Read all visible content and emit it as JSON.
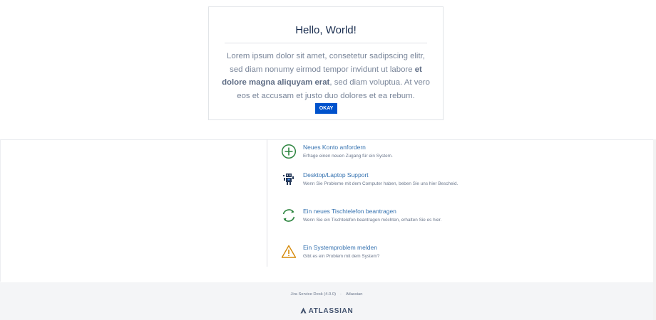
{
  "dialog": {
    "title": "Hello, World!",
    "text_part1": "Lorem ipsum dolor sit amet, consetetur sadipscing elitr, sed diam nonumy eirmod tempor invidunt ut labore ",
    "text_bold": "et dolore magna aliquyam erat",
    "text_part2": ", sed diam voluptua. At vero eos et accusam et justo duo dolores et ea rebum.",
    "button_label": "OKAY"
  },
  "request_types": [
    {
      "title": "Neues Konto anfordern",
      "description": "Erfrage einen neuen Zugang für ein System.",
      "icon": "add-circle-icon",
      "color": "#2e8540"
    },
    {
      "title": "Desktop/Laptop Support",
      "description": "Wenn Sie Probleme mit dem Computer haben, beben Sie uns hier Bescheid.",
      "icon": "robot-icon",
      "color": "#253858"
    },
    {
      "title": "Ein neues Tischtelefon beantragen",
      "description": "Wenn Sie ein Tischtelefon beantragen möchten, erhalten Sie es hier.",
      "icon": "refresh-icon",
      "color": "#2e8540"
    },
    {
      "title": "Ein Systemproblem melden",
      "description": "Gibt es ein Problem mit dem System?",
      "icon": "warning-icon",
      "color": "#d68a0a"
    }
  ],
  "footer": {
    "product": "Jira Service Desk (4.0.0)",
    "separator": "·",
    "vendor": "Atlassian",
    "brand": "ATLASSIAN"
  },
  "colors": {
    "accent": "#0052cc",
    "link": "#3572b0"
  }
}
